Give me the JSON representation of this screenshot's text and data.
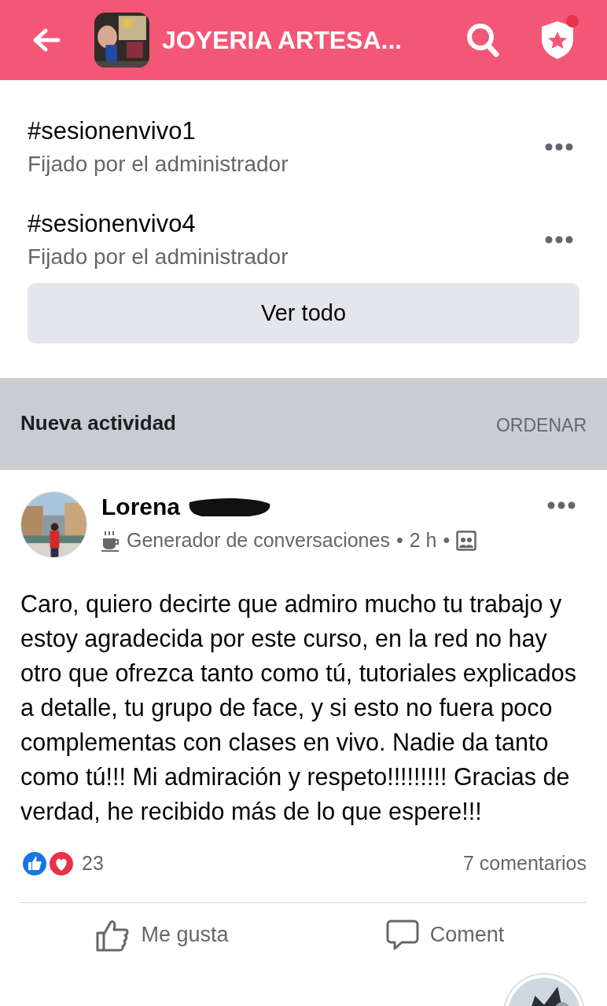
{
  "header": {
    "title": "JOYERIA ARTESA...",
    "notification_dot": true
  },
  "pinned": [
    {
      "title": "#sesionenvivo1",
      "subtitle": "Fijado por el administrador"
    },
    {
      "title": "#sesionenvivo4",
      "subtitle": "Fijado por el administrador"
    }
  ],
  "see_all": "Ver todo",
  "activity": {
    "title": "Nueva actividad",
    "sort": "ORDENAR"
  },
  "post": {
    "author": "Lorena",
    "badge": "Generador de conversaciones",
    "time": "2 h",
    "separator": "•",
    "body": "Caro, quiero decirte que admiro mucho tu trabajo y estoy agradecida por este curso, en la red no hay otro que ofrezca tanto como tú, tutoriales explicados a detalle, tu grupo de face, y si esto no fuera poco complementas con clases en vivo. Nadie da tanto como tú!!! Mi admiración y respeto!!!!!!!!! Gracias de verdad, he recibido más de lo que espere!!!",
    "reactions": "23",
    "comments": "7 comentarios",
    "actions": [
      "Me gusta",
      "Coment"
    ]
  }
}
